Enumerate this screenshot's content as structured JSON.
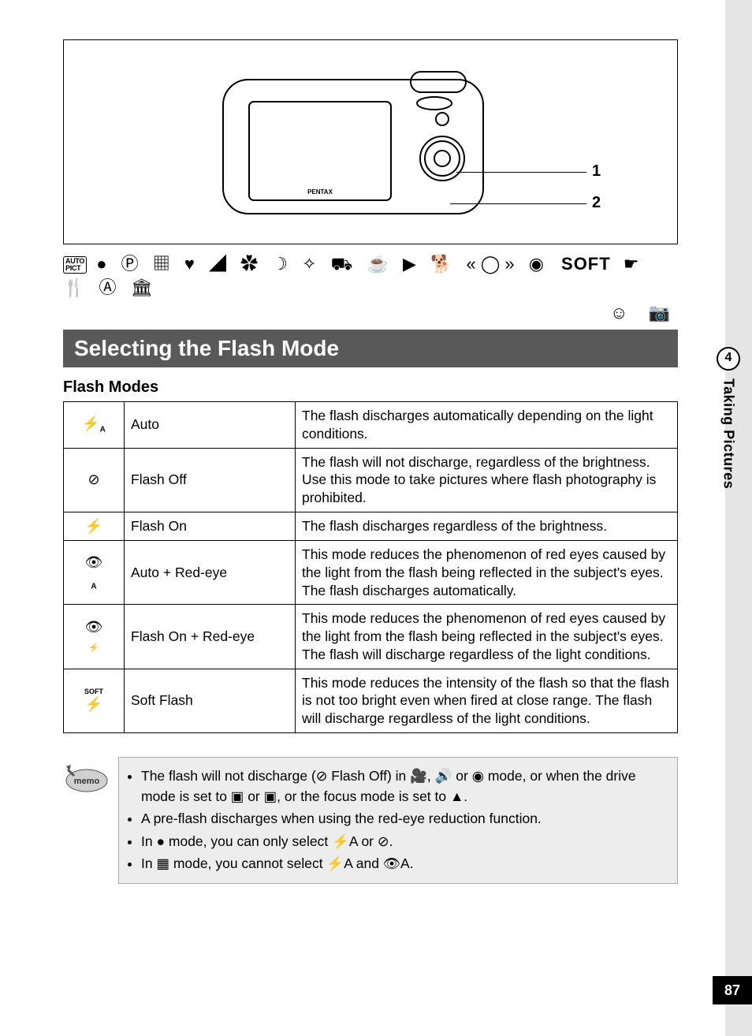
{
  "sidebar": {
    "chapter_number": "4",
    "chapter_title": "Taking Pictures",
    "page_number": "87"
  },
  "diagram": {
    "brand": "PENTAX",
    "callouts": [
      "1",
      "2"
    ]
  },
  "mode_row_soft": "SOFT",
  "mode_row_auto_pict": "AUTO\nPICT",
  "section_title": "Selecting the Flash Mode",
  "subheading": "Flash Modes",
  "table": [
    {
      "icon": "⚡A",
      "name": "Auto",
      "desc": "The flash discharges automatically depending on the light conditions."
    },
    {
      "icon": "⊘⚡",
      "name": "Flash Off",
      "desc": "The flash will not discharge, regardless of the brightness. Use this mode to take pictures where flash photography is prohibited."
    },
    {
      "icon": "⚡",
      "name": "Flash On",
      "desc": "The flash discharges regardless of the brightness."
    },
    {
      "icon": "👁A",
      "name": "Auto + Red-eye",
      "desc": "This mode reduces the phenomenon of red eyes caused by the light from the flash being reflected in the subject's eyes. The flash discharges automatically."
    },
    {
      "icon": "👁⚡",
      "name": "Flash On + Red-eye",
      "desc": "This mode reduces the phenomenon of red eyes caused by the light from the flash being reflected in the subject's eyes. The flash will discharge regardless of the light conditions."
    },
    {
      "icon": "SOFT⚡",
      "name": "Soft Flash",
      "desc": "This mode reduces the intensity of the flash so that the flash is not too bright even when fired at close range. The flash will discharge regardless of the light conditions."
    }
  ],
  "memo": {
    "label": "memo",
    "items": [
      "The flash will not discharge (⊘ Flash Off) in 🎥, 🔊 or ◉ mode, or when the drive mode is set to ▣ or ▣, or the focus mode is set to ▲.",
      "A pre-flash discharges when using the red-eye reduction function.",
      "In ● mode, you can only select ⚡A or ⊘.",
      "In ▦ mode, you cannot select ⚡A and 👁A."
    ]
  }
}
